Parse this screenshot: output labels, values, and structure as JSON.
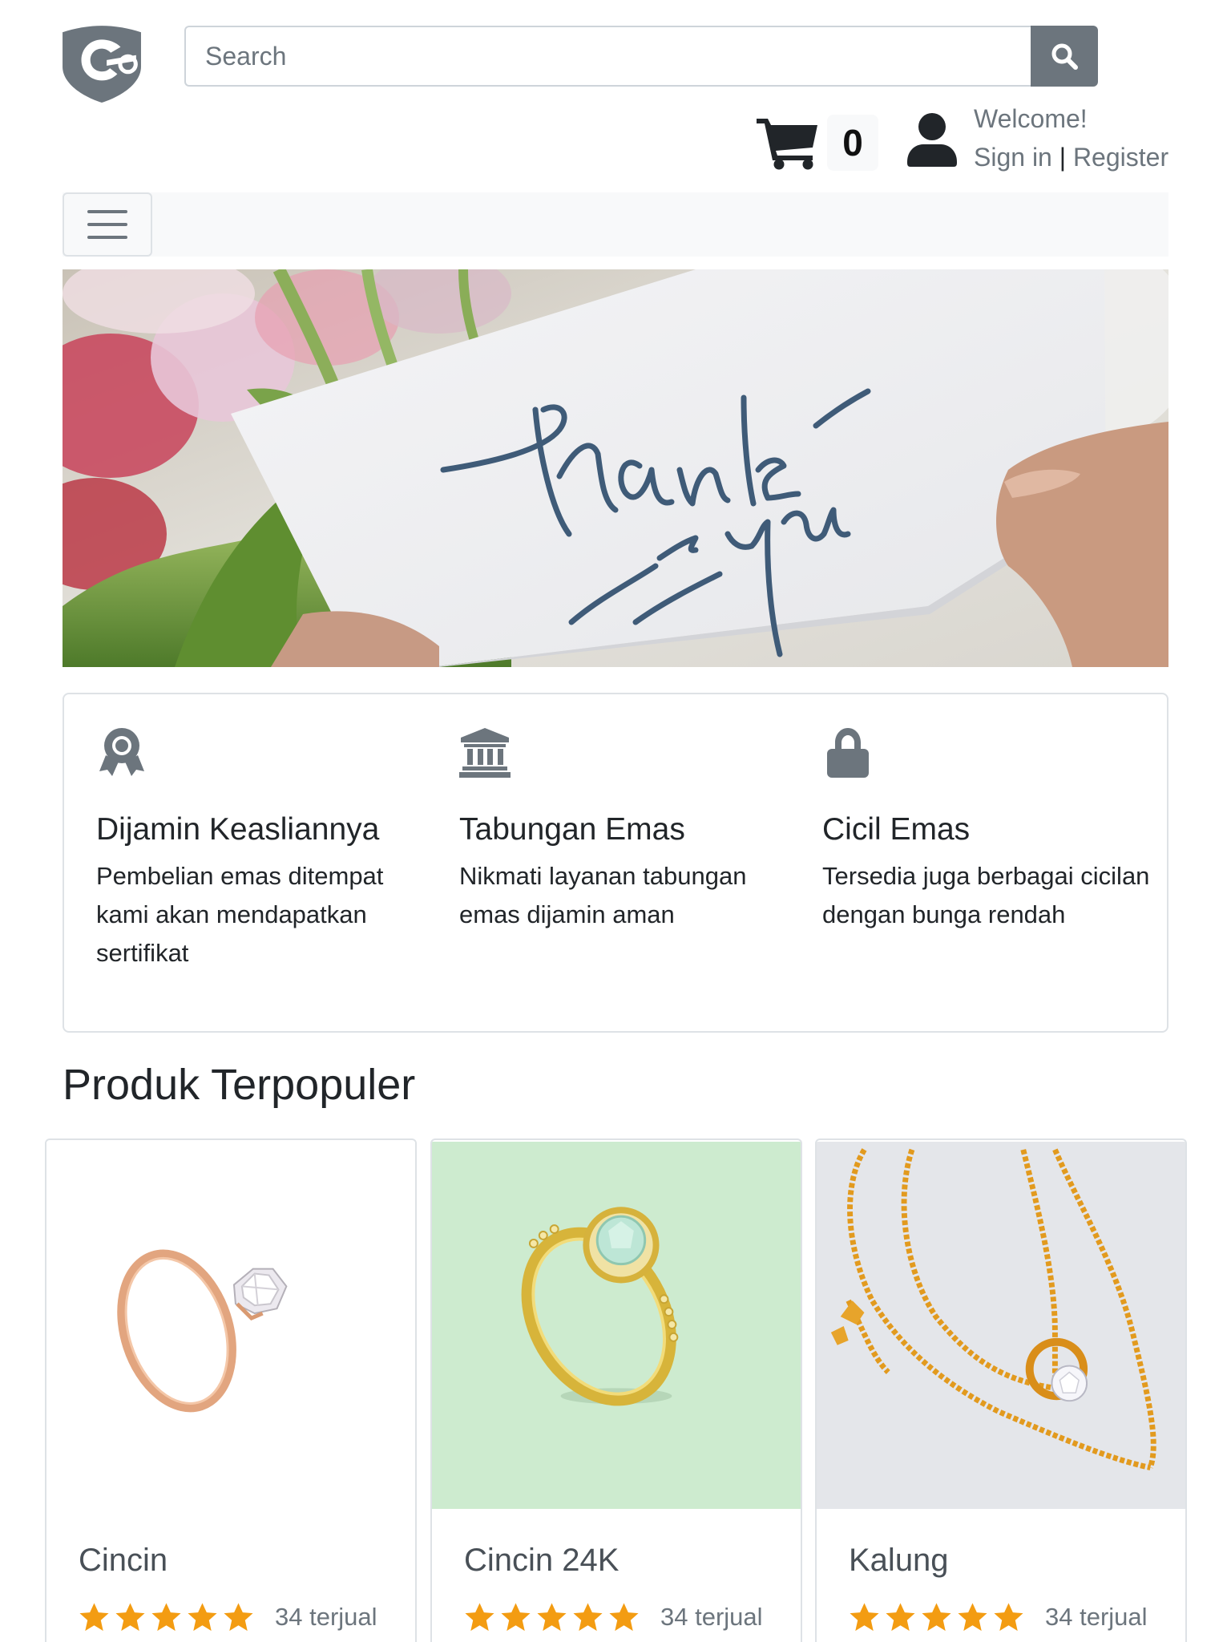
{
  "header": {
    "logo_name": "shield-logo",
    "search": {
      "placeholder": "Search"
    },
    "cart": {
      "count": "0"
    },
    "user": {
      "welcome": "Welcome!",
      "sign_in": "Sign in",
      "separator": "|",
      "register": "Register"
    }
  },
  "features": [
    {
      "icon": "award-icon",
      "title": "Dijamin Keasliannya",
      "text": "Pembelian emas ditempat kami akan mendapatkan sertifikat"
    },
    {
      "icon": "bank-icon",
      "title": "Tabungan Emas",
      "text": "Nikmati layanan tabungan emas dijamin aman"
    },
    {
      "icon": "lock-icon",
      "title": "Cicil Emas",
      "text": "Tersedia juga berbagai cicilan dengan bunga rendah"
    }
  ],
  "section_title": "Produk Terpopuler",
  "products": [
    {
      "name": "Cincin",
      "rating": 5,
      "sold": "34 terjual"
    },
    {
      "name": "Cincin 24K",
      "rating": 5,
      "sold": "34 terjual"
    },
    {
      "name": "Kalung",
      "rating": 5,
      "sold": "34 terjual"
    }
  ],
  "colors": {
    "accent": "#6c757d",
    "star": "#f39c12",
    "border": "#dee2e6",
    "green_bg": "#cdebcf"
  }
}
